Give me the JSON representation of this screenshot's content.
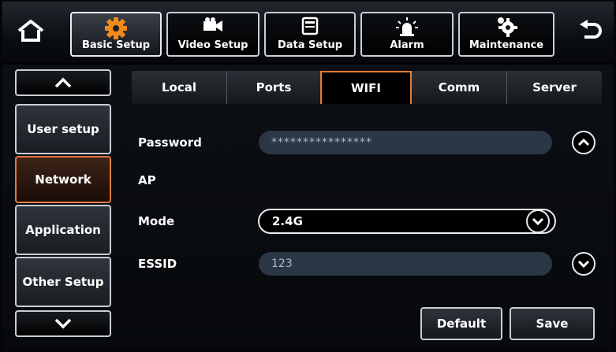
{
  "top_tabs": [
    {
      "label": "Basic Setup",
      "icon": "gear-icon",
      "active": true
    },
    {
      "label": "Video Setup",
      "icon": "video-camera-icon",
      "active": false
    },
    {
      "label": "Data Setup",
      "icon": "data-disk-icon",
      "active": false
    },
    {
      "label": "Alarm",
      "icon": "alarm-light-icon",
      "active": false
    },
    {
      "label": "Maintenance",
      "icon": "maintenance-gear-icon",
      "active": false
    }
  ],
  "side_menu": [
    {
      "label": "User setup",
      "active": false
    },
    {
      "label": "Network",
      "active": true
    },
    {
      "label": "Application",
      "active": false
    },
    {
      "label": "Other Setup",
      "active": false
    }
  ],
  "sub_tabs": [
    {
      "label": "Local",
      "active": false
    },
    {
      "label": "Ports",
      "active": false
    },
    {
      "label": "WIFI",
      "active": true
    },
    {
      "label": "Comm",
      "active": false
    },
    {
      "label": "Server",
      "active": false
    }
  ],
  "form": {
    "password_label": "Password",
    "password_value": "****************",
    "ap_label": "AP",
    "mode_label": "Mode",
    "mode_value": "2.4G",
    "essid_label": "ESSID",
    "essid_value": "123"
  },
  "buttons": {
    "default_label": "Default",
    "save_label": "Save"
  },
  "colors": {
    "accent": "#e87a2c",
    "field_bg": "#2b3647"
  }
}
